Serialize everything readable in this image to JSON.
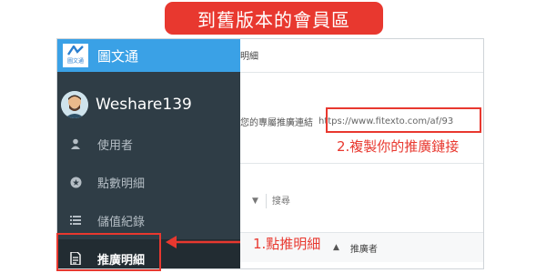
{
  "banner": {
    "text": "到舊版本的會員區"
  },
  "sidebar": {
    "logo_text": "圖文通",
    "app_title": "圖文通",
    "username": "Weshare139",
    "items": [
      {
        "label": "使用者",
        "icon": "user-icon"
      },
      {
        "label": "點數明細",
        "icon": "coin-icon"
      },
      {
        "label": "儲值紀錄",
        "icon": "list-icon"
      },
      {
        "label": "推廣明細",
        "icon": "document-icon",
        "active": true
      }
    ]
  },
  "main": {
    "tab_label": "明細",
    "referral_label": "您的專屬推廣連結",
    "referral_url": "https://www.fitexto.com/af/93",
    "search_placeholder": "搜尋",
    "table_header": "推廣者"
  },
  "annotations": {
    "step1": "1.點推明細",
    "step2": "2.複製你的推廣鏈接"
  },
  "colors": {
    "accent_red": "#e8382f",
    "sidebar_bg": "#2f3d46",
    "header_blue": "#3aa1e6"
  }
}
